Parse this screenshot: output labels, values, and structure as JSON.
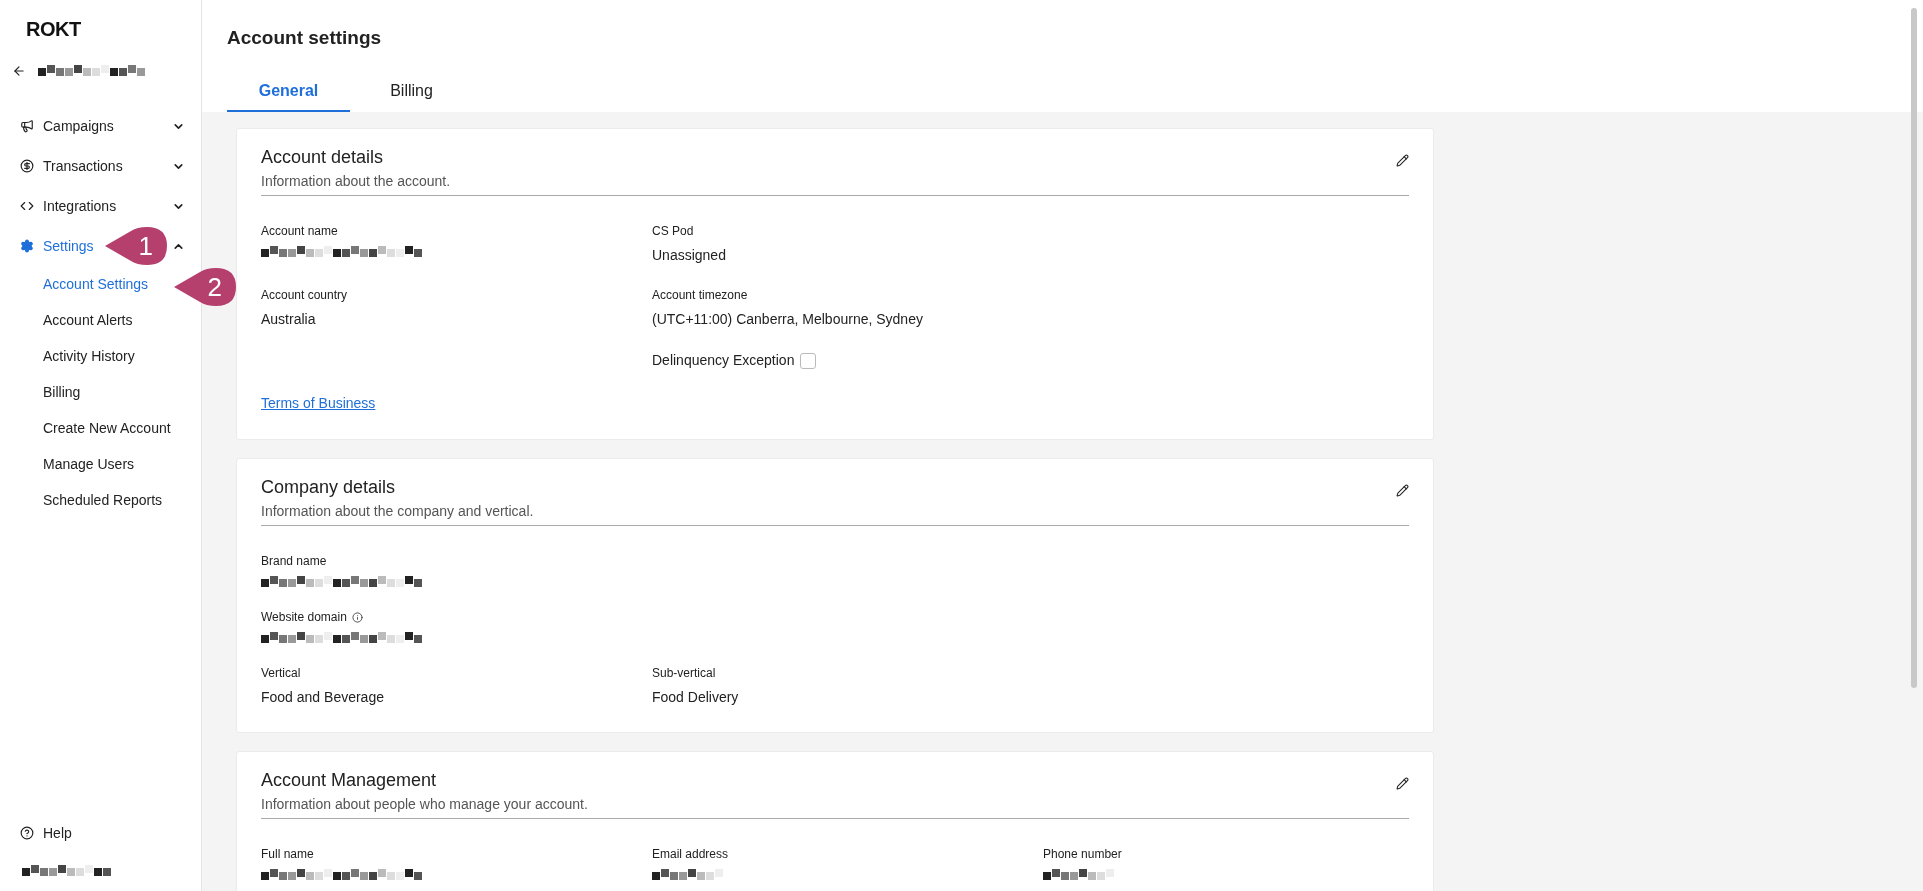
{
  "sidebar": {
    "logo": "ROKT",
    "items": [
      {
        "label": "Campaigns",
        "expanded": false,
        "selected": false
      },
      {
        "label": "Transactions",
        "expanded": false,
        "selected": false
      },
      {
        "label": "Integrations",
        "expanded": false,
        "selected": false
      },
      {
        "label": "Settings",
        "expanded": true,
        "selected": true,
        "children": [
          {
            "label": "Account Settings",
            "selected": true
          },
          {
            "label": "Account Alerts",
            "selected": false
          },
          {
            "label": "Activity History",
            "selected": false
          },
          {
            "label": "Billing",
            "selected": false
          },
          {
            "label": "Create New Account",
            "selected": false
          },
          {
            "label": "Manage Users",
            "selected": false
          },
          {
            "label": "Scheduled Reports",
            "selected": false
          }
        ]
      }
    ],
    "help": "Help"
  },
  "callouts": [
    {
      "label": "1"
    },
    {
      "label": "2"
    }
  ],
  "page": {
    "title": "Account settings"
  },
  "tabs": [
    {
      "label": "General",
      "selected": true
    },
    {
      "label": "Billing",
      "selected": false
    }
  ],
  "cards": [
    {
      "title": "Account details",
      "subtitle": "Information about the account.",
      "rows": [
        [
          {
            "kind": "redacted",
            "label": "Account name"
          },
          {
            "kind": "text",
            "label": "CS Pod",
            "value": "Unassigned"
          }
        ],
        [
          {
            "kind": "text",
            "label": "Account country",
            "value": "Australia"
          },
          {
            "kind": "text",
            "label": "Account timezone",
            "value": "(UTC+11:00) Canberra, Melbourne, Sydney"
          }
        ],
        [
          {
            "kind": "empty"
          },
          {
            "kind": "checkbox",
            "label": "Delinquency Exception",
            "checked": false
          }
        ],
        [
          {
            "kind": "link",
            "value": "Terms of Business"
          }
        ]
      ]
    },
    {
      "title": "Company details",
      "subtitle": "Information about the company and vertical.",
      "rows": [
        [
          {
            "kind": "redacted",
            "label": "Brand name"
          }
        ],
        [
          {
            "kind": "redacted",
            "label": "Website domain",
            "info": true
          }
        ],
        [
          {
            "kind": "text",
            "label": "Vertical",
            "value": "Food and Beverage"
          },
          {
            "kind": "text",
            "label": "Sub-vertical",
            "value": "Food Delivery"
          }
        ]
      ]
    },
    {
      "title": "Account Management",
      "subtitle": "Information about people who manage your account.",
      "rows": [
        [
          {
            "kind": "redacted",
            "label": "Full name"
          },
          {
            "kind": "redacted",
            "label": "Email address"
          },
          {
            "kind": "redacted",
            "label": "Phone number"
          }
        ]
      ]
    }
  ]
}
